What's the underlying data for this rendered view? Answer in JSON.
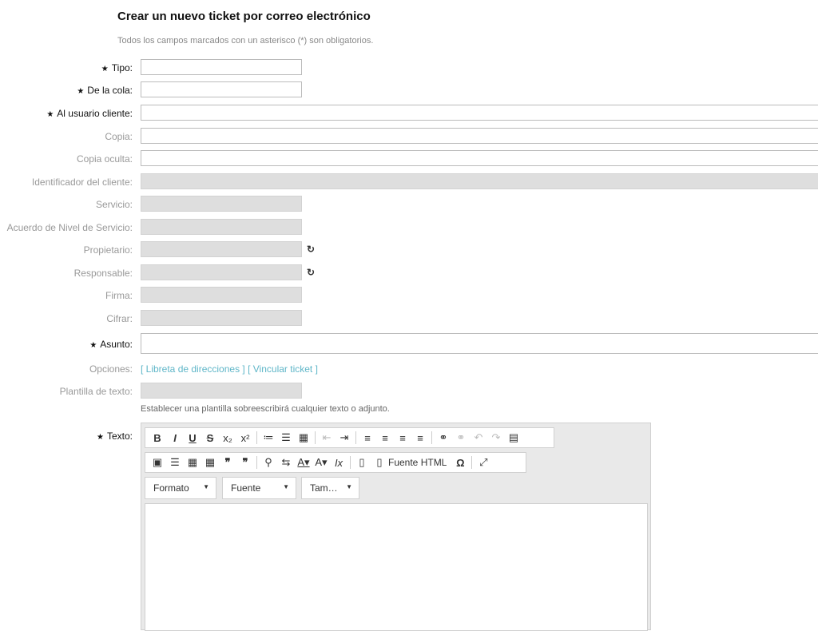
{
  "page": {
    "title": "Crear un nuevo ticket por correo electrónico",
    "subtitle": "Todos los campos marcados con un asterisco (*) son obligatorios."
  },
  "form": {
    "required_marker": "★",
    "fields": {
      "tipo": "Tipo:",
      "cola": "De la cola:",
      "usuario": "Al usuario cliente:",
      "copia": "Copia:",
      "copia_oculta": "Copia oculta:",
      "identificador": "Identificador del cliente:",
      "servicio": "Servicio:",
      "sla": "Acuerdo de Nivel de Servicio:",
      "propietario": "Propietario:",
      "responsable": "Responsable:",
      "firma": "Firma:",
      "cifrar": "Cifrar:",
      "asunto": "Asunto:",
      "opciones": "Opciones:",
      "plantilla": "Plantilla de texto:",
      "texto": "Texto:"
    },
    "options_links": {
      "libreta": "[ Libreta de direcciones ]",
      "vincular": "[ Vincular ticket ]"
    },
    "template_hint": "Establecer una plantilla sobreescribirá cualquier texto o adjunto.",
    "refresh_icon": "↻"
  },
  "editor": {
    "source_label": "Fuente HTML",
    "format_select": "Formato",
    "font_select": "Fuente",
    "size_select": "Tam…",
    "toolbar_row1": [
      "B",
      "I",
      "U",
      "S",
      "x₂",
      "x²",
      "≔",
      "☰",
      "▦",
      "⇤",
      "⇥",
      "≡",
      "≡",
      "≡",
      "≡",
      "⚭",
      "⚭",
      "↶",
      "↷",
      "▤"
    ],
    "toolbar_row2": [
      "▣",
      "☰",
      "▦",
      "▦",
      "❞",
      "❞",
      "⚲",
      "⇆",
      "A▾",
      "A▾",
      "Ix",
      "▯",
      "▯",
      "Ω",
      "⤢"
    ]
  }
}
